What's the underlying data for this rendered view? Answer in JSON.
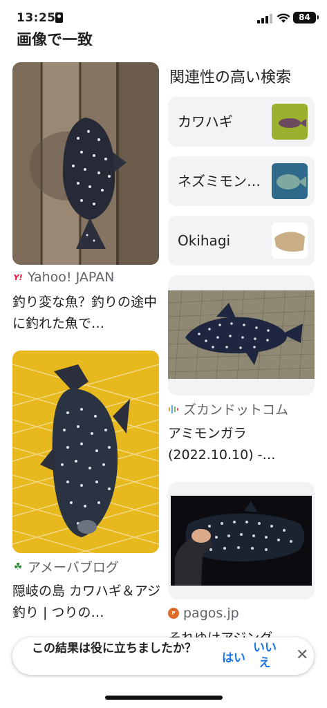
{
  "status_bar": {
    "time": "13:25",
    "battery": "84"
  },
  "partial_heading": "画像で一致",
  "left_results": [
    {
      "source": "Yahoo! JAPAN",
      "title": "釣り変な魚？釣りの途中に釣れた魚で…"
    },
    {
      "source": "アメーバブログ",
      "title": "隠岐の島 カワハギ＆アジ釣り | つりの…"
    }
  ],
  "related": {
    "title": "関連性の高い検索",
    "items": [
      {
        "label": "カワハギ"
      },
      {
        "label": "ネズミモン…"
      },
      {
        "label": "Okihagi"
      }
    ]
  },
  "right_results": [
    {
      "source": "ズカンドットコム",
      "title": "アミモンガラ (2022.10.10) -…"
    },
    {
      "source": "pagos.jp",
      "title": "それゆけアジング"
    }
  ],
  "feedback": {
    "question": "この結果は役に立ちましたか？",
    "yes": "はい",
    "no": "いいえ"
  }
}
